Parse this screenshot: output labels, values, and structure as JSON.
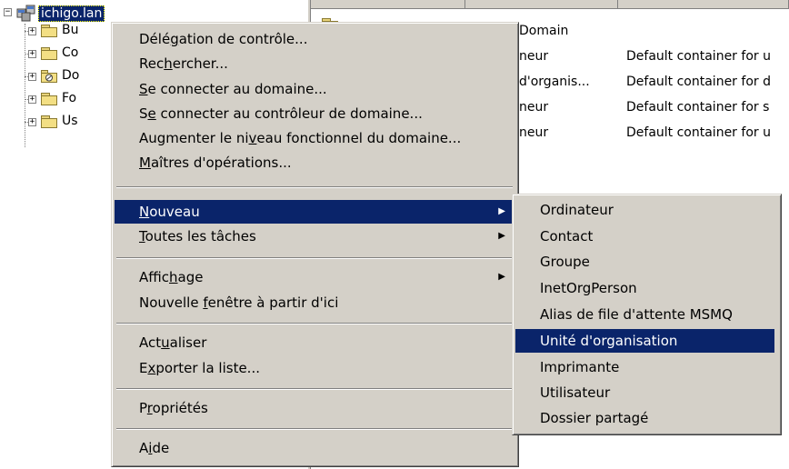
{
  "tree": {
    "root_label": "ichigo.lan",
    "children": [
      "Bu",
      "Co",
      "Do",
      "Fo",
      "Us"
    ]
  },
  "list": {
    "rows": [
      {
        "type": "Domain",
        "description": ""
      },
      {
        "type": "neur",
        "description": "Default container for u"
      },
      {
        "type": "d'organis...",
        "description": "Default container for d"
      },
      {
        "type": "neur",
        "description": "Default container for s"
      },
      {
        "type": "neur",
        "description": "Default container for u"
      }
    ]
  },
  "context_menu": {
    "items": [
      {
        "pre": "Délé",
        "u": "g",
        "post": "ation de contrôle..."
      },
      {
        "pre": "Rec",
        "u": "h",
        "post": "ercher..."
      },
      {
        "pre": "",
        "u": "S",
        "post": "e connecter au domaine..."
      },
      {
        "pre": "S",
        "u": "e",
        "post": " connecter au contrôleur de domaine..."
      },
      {
        "pre": "Augmenter le ni",
        "u": "v",
        "post": "eau fonctionnel du domaine..."
      },
      {
        "pre": "",
        "u": "M",
        "post": "aîtres d'opérations..."
      },
      {
        "pre": "",
        "u": "N",
        "post": "ouveau"
      },
      {
        "pre": "",
        "u": "T",
        "post": "outes les tâches"
      },
      {
        "pre": "Affic",
        "u": "h",
        "post": "age"
      },
      {
        "pre": "Nouvelle ",
        "u": "f",
        "post": "enêtre à partir d'ici"
      },
      {
        "pre": "Act",
        "u": "u",
        "post": "aliser"
      },
      {
        "pre": "E",
        "u": "x",
        "post": "porter la liste..."
      },
      {
        "pre": "P",
        "u": "r",
        "post": "opriétés"
      },
      {
        "pre": "A",
        "u": "i",
        "post": "de"
      }
    ],
    "highlighted": "Nouveau"
  },
  "submenu": {
    "items": [
      "Ordinateur",
      "Contact",
      "Groupe",
      "InetOrgPerson",
      "Alias de file d'attente MSMQ",
      "Unité d'organisation",
      "Imprimante",
      "Utilisateur",
      "Dossier partagé"
    ],
    "highlighted": "Unité d'organisation"
  },
  "colors": {
    "menu_bg": "#d4d0c8",
    "highlight": "#0a246a",
    "folder": "#f3df84"
  }
}
